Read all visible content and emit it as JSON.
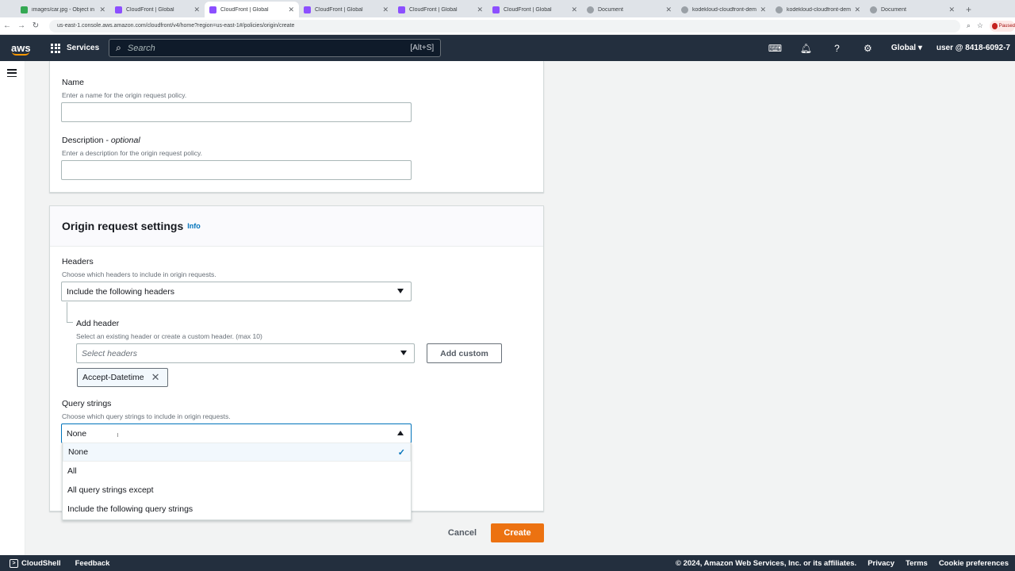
{
  "browser": {
    "tabs": [
      {
        "label": "images/car.jpg - Object in S3",
        "color": "#34a853",
        "active": false
      },
      {
        "label": "CloudFront | Global",
        "color": "#8c4fff",
        "active": false
      },
      {
        "label": "CloudFront | Global",
        "color": "#8c4fff",
        "active": true
      },
      {
        "label": "CloudFront | Global",
        "color": "#8c4fff",
        "active": false
      },
      {
        "label": "CloudFront | Global",
        "color": "#8c4fff",
        "active": false
      },
      {
        "label": "CloudFront | Global",
        "color": "#8c4fff",
        "active": false
      },
      {
        "label": "Document",
        "color": "#5f6368",
        "active": false
      },
      {
        "label": "kodekloud-cloudfront-demo",
        "color": "#5f6368",
        "active": false
      },
      {
        "label": "kodekloud-cloudfront-demo",
        "color": "#5f6368",
        "active": false
      },
      {
        "label": "Document",
        "color": "#5f6368",
        "active": false
      }
    ],
    "url": "us-east-1.console.aws.amazon.com/cloudfront/v4/home?region=us-east-1#/policies/origin/create",
    "profile_label": "Paused"
  },
  "nav": {
    "logo": "aws",
    "services": "Services",
    "search_placeholder": "Search",
    "search_shortcut": "[Alt+S]",
    "region": "Global ▾",
    "user": "user @ 8418-6092-7"
  },
  "form": {
    "name_label": "Name",
    "name_desc": "Enter a name for the origin request policy.",
    "description_label": "Description",
    "description_optional": "optional",
    "description_desc": "Enter a description for the origin request policy.",
    "settings_title": "Origin request settings",
    "info_link": "Info",
    "headers_label": "Headers",
    "headers_desc": "Choose which headers to include in origin requests.",
    "headers_value": "Include the following headers",
    "add_header_label": "Add header",
    "add_header_desc": "Select an existing header or create a custom header. (max 10)",
    "select_headers_placeholder": "Select headers",
    "add_custom_button": "Add custom",
    "token": "Accept-Datetime",
    "query_label": "Query strings",
    "query_desc": "Choose which query strings to include in origin requests.",
    "query_value": "None",
    "query_options": [
      "None",
      "All",
      "All query strings except",
      "Include the following query strings"
    ]
  },
  "actions": {
    "cancel": "Cancel",
    "create": "Create"
  },
  "footer": {
    "cloudshell": "CloudShell",
    "feedback": "Feedback",
    "copyright": "© 2024, Amazon Web Services, Inc. or its affiliates.",
    "privacy": "Privacy",
    "terms": "Terms",
    "cookie": "Cookie preferences"
  },
  "colors": {
    "nav_bg": "#232f3e",
    "primary_button": "#ec7211",
    "link": "#0073bb"
  }
}
